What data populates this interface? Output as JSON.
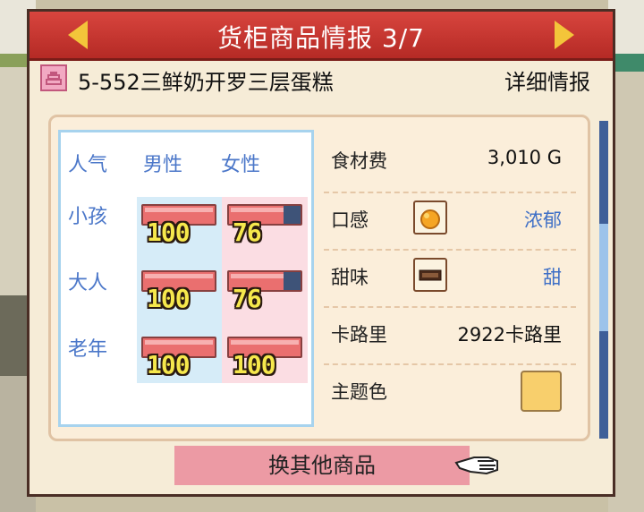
{
  "header": {
    "title": "货柜商品情报 3/7"
  },
  "product": {
    "name": "5-552三鲜奶开罗三层蛋糕",
    "detail_label": "详细情报"
  },
  "popularity": {
    "labels": {
      "corner": "人气",
      "male": "男性",
      "female": "女性"
    },
    "rows": [
      {
        "label": "小孩",
        "male": 100,
        "female": 76
      },
      {
        "label": "大人",
        "male": 100,
        "female": 76
      },
      {
        "label": "老年",
        "male": 100,
        "female": 100
      }
    ]
  },
  "attributes": {
    "cost": {
      "label": "食材费",
      "value": "3,010 G"
    },
    "texture": {
      "label": "口感",
      "value": "浓郁",
      "icon": "thick-texture-icon"
    },
    "sweetness": {
      "label": "甜味",
      "value": "甜",
      "icon": "sweetness-level-icon"
    },
    "calories": {
      "label": "卡路里",
      "value": "2922卡路里"
    },
    "theme_color": {
      "label": "主题色",
      "color": "#f8cf6c"
    }
  },
  "footer": {
    "swap_label": "换其他商品"
  },
  "colors": {
    "header": "#c9342f",
    "arrow": "#f3c53a",
    "accent_blue": "#4b77c9",
    "gauge_fill": "#ea6f6f",
    "gauge_empty": "#3e5378"
  }
}
